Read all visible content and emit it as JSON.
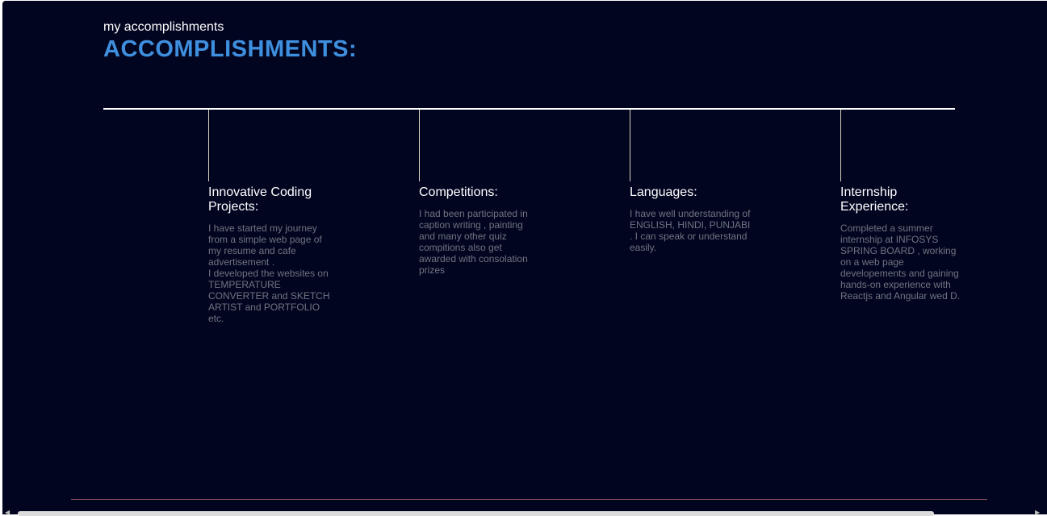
{
  "section": {
    "subtitle": "my accomplishments",
    "title": "ACCOMPLISHMENTS:"
  },
  "cards": [
    {
      "title": "Innovative Coding Projects:",
      "text": "I have started my journey from a simple web page of my resume and cafe advertisement .\nI developed the websites on TEMPERATURE CONVERTER and SKETCH ARTIST and PORTFOLIO etc."
    },
    {
      "title": "Competitions:",
      "text": "I had been participated in caption writing , painting and many other quiz compitions also get awarded with consolation prizes"
    },
    {
      "title": "Languages:",
      "text": "I have well understanding of ENGLISH, HINDI, PUNJABI . I can speak or understand easily."
    },
    {
      "title": "Internship Experience:",
      "text": "Completed a summer internship at INFOSYS SPRING BOARD , working on a web page developements and gaining hands-on experience with Reactjs and Angular wed D."
    }
  ],
  "colors": {
    "background": "#020520",
    "accent": "#3f8fdf",
    "body_text": "#6f7480"
  },
  "icons": {
    "scroll_left": "scroll-left-arrow-icon",
    "scroll_right": "scroll-right-arrow-icon"
  }
}
